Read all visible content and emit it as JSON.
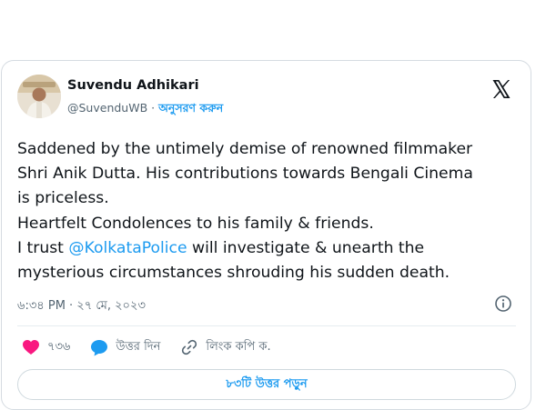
{
  "tweet": {
    "author_name": "Suvendu Adhikari",
    "handle": "@SuvenduWB",
    "separator": " · ",
    "follow_label": "অনুসরণ করুন",
    "text_lines": {
      "l1": "Saddened by the untimely demise of renowned filmmaker",
      "l2": "Shri Anik Dutta. His contributions towards Bengali Cinema",
      "l3": "is priceless.",
      "l4": "Heartfelt Condolences to his family & friends.",
      "l5_prefix": "I trust ",
      "l5_mention": "@KolkataPolice",
      "l5_suffix": " will investigate & unearth the",
      "l6": "mysterious circumstances shrouding his sudden death."
    },
    "timestamp": "৬:৩৪ PM · ২৭ মে, ২০২৩",
    "likes": "৭৩৬",
    "reply_label": "উত্তর দিন",
    "copy_link_label": "লিংক কপি ক.",
    "read_replies_label": "৮৩টি উত্তর পড়ুন"
  },
  "icons": {
    "brand": "x-logo-icon",
    "info": "info-icon",
    "like": "heart-icon",
    "reply": "reply-bubble-icon",
    "link": "link-icon"
  },
  "colors": {
    "accent": "#1d9bf0",
    "like": "#f91880",
    "text": "#0f1419",
    "muted": "#536471",
    "border": "#d5dbe1"
  }
}
